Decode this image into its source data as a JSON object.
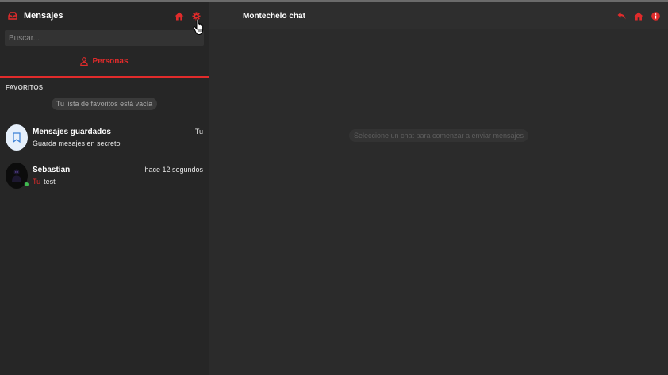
{
  "sidebar": {
    "title": "Mensajes",
    "search_placeholder": "Buscar...",
    "tab_label": "Personas",
    "favorites_title": "FAVORITOS",
    "favorites_empty": "Tu lista de favoritos está vacía",
    "chats": [
      {
        "name": "Mensajes guardados",
        "time": "Tu",
        "subtitle": "Guarda mesajes en secreto"
      },
      {
        "name": "Sebastian",
        "time": "hace 12 segundos",
        "sender": "Tu",
        "message": "test"
      }
    ]
  },
  "main": {
    "title": "Montechelo chat",
    "hint": "Seleccione un chat para comenzar a enviar mensajes"
  },
  "colors": {
    "accent": "#e12b2b",
    "sidebar_bg": "#262626",
    "main_bg": "#2b2b2b",
    "online": "#3fb950"
  },
  "icons": [
    "inbox-icon",
    "home-icon",
    "gear-icon",
    "user-icon",
    "bookmark-icon",
    "reply-icon",
    "info-icon",
    "hand-cursor-icon"
  ]
}
